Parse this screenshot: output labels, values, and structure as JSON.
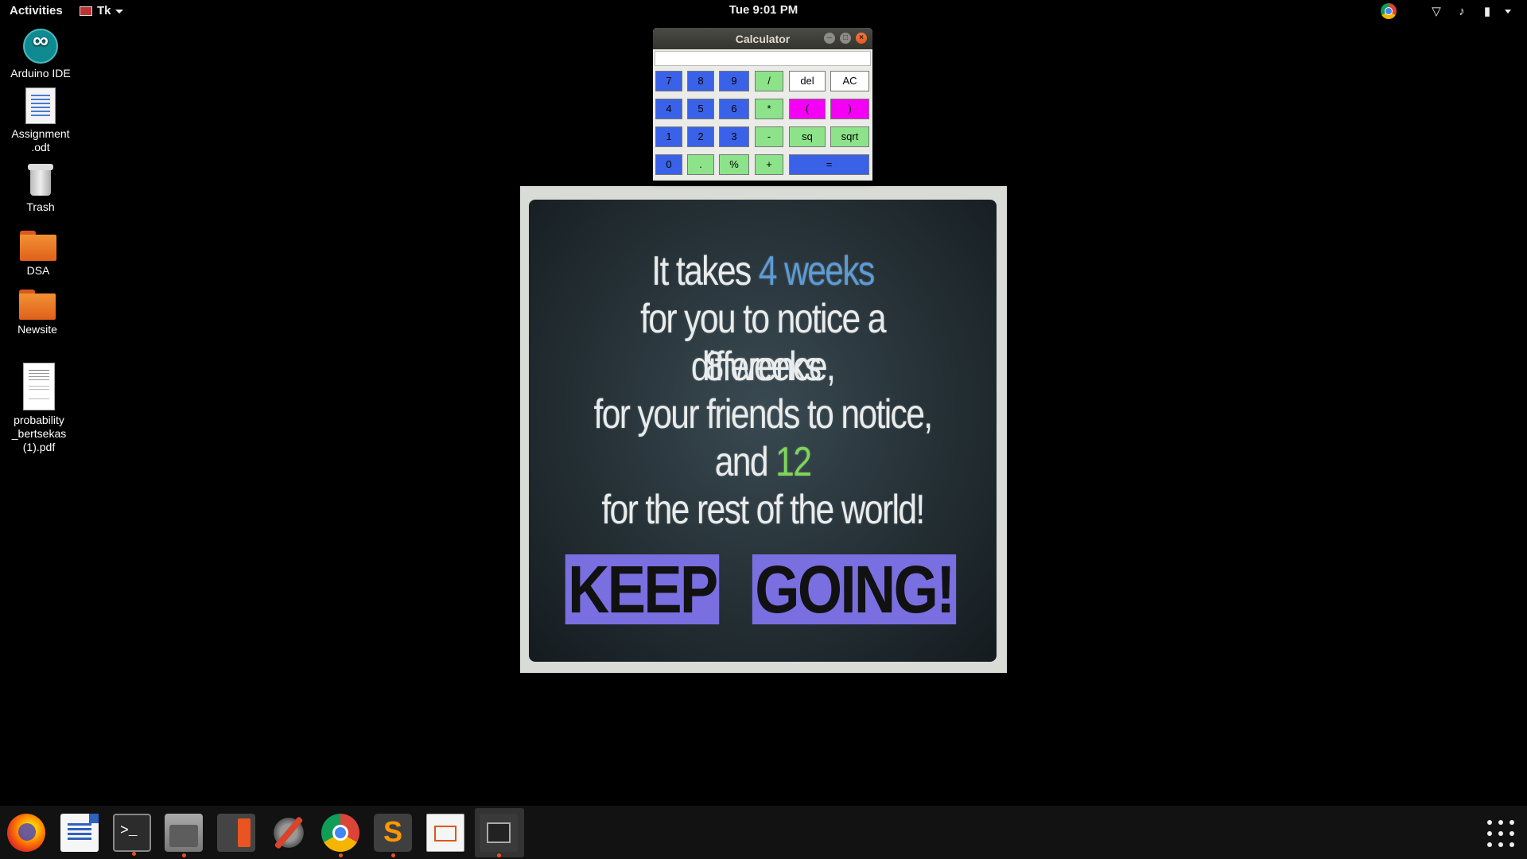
{
  "topbar": {
    "activities": "Activities",
    "app_menu": "Tk",
    "clock": "Tue  9:01 PM"
  },
  "desktop": {
    "icons": [
      {
        "label": "Arduino IDE",
        "icon": "arduino-icon"
      },
      {
        "label": "Assignment\n.odt",
        "icon": "document-icon"
      },
      {
        "label": "Trash",
        "icon": "trash-icon"
      },
      {
        "label": "DSA",
        "icon": "folder-icon"
      },
      {
        "label": "Newsite",
        "icon": "folder-icon"
      },
      {
        "label": "probability\n_bertsekas\n(1).pdf",
        "icon": "pdf-icon"
      }
    ]
  },
  "calculator": {
    "title": "Calculator",
    "display_value": "",
    "buttons": {
      "b7": "7",
      "b8": "8",
      "b9": "9",
      "div": "/",
      "del": "del",
      "ac": "AC",
      "b4": "4",
      "b5": "5",
      "b6": "6",
      "mul": "*",
      "lparen": "(",
      "rparen": ")",
      "b1": "1",
      "b2": "2",
      "b3": "3",
      "sub": "-",
      "sq": "sq",
      "sqrt": "sqrt",
      "b0": "0",
      "dot": ".",
      "pct": "%",
      "add": "+",
      "eq": "="
    },
    "colors": {
      "number": "#3a62e8",
      "operator": "#8de38a",
      "paren": "#f400f4",
      "clear": "#ffffff"
    }
  },
  "poster": {
    "line1_a": "It takes ",
    "line1_b": "4 weeks",
    "line2": "for you to notice a difference,",
    "line3": "8 weeks",
    "line4": "for your friends to notice,",
    "line5_a": "and ",
    "line5_b": "12",
    "line6": "for the rest of the world!",
    "banner_1": "KEEP",
    "banner_2": "GOING!"
  },
  "dock": {
    "apps": [
      "Firefox",
      "LibreOffice Writer",
      "Terminal",
      "Files",
      "Calculator",
      "Settings",
      "Google Chrome",
      "Sublime Text",
      "LibreOffice Impress",
      "Image Viewer"
    ],
    "accent": "#e95420"
  }
}
